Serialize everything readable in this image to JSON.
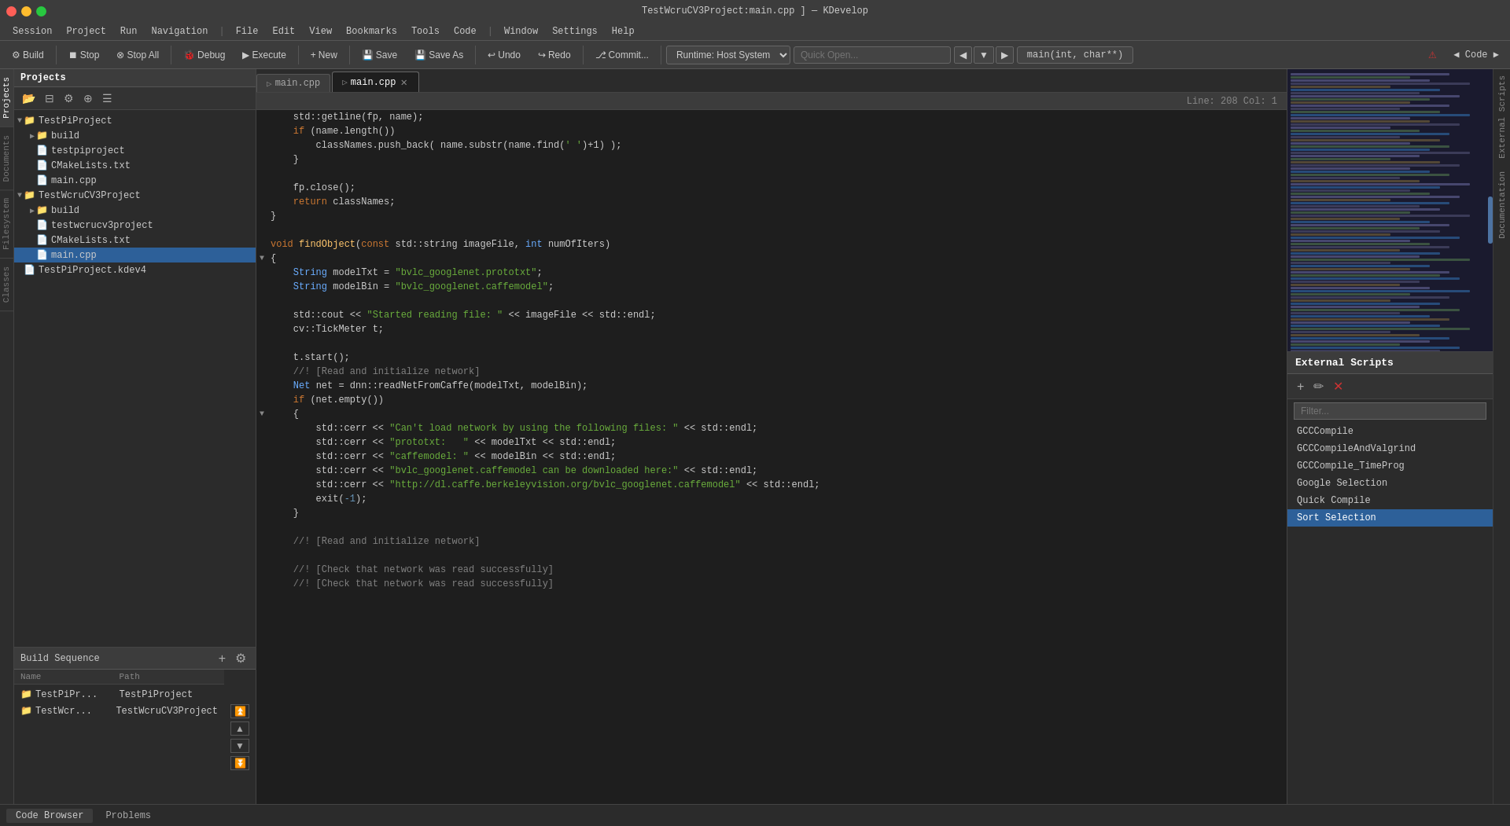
{
  "window": {
    "title": "TestWcruCV3Project:main.cpp ] — KDevelop"
  },
  "window_buttons": {
    "close": "●",
    "minimize": "●",
    "maximize": "●"
  },
  "menubar": {
    "items": [
      "Session",
      "Project",
      "Run",
      "Navigation",
      "|",
      "File",
      "Edit",
      "View",
      "Bookmarks",
      "Tools",
      "Code",
      "|",
      "Window",
      "Settings",
      "Help"
    ]
  },
  "toolbar": {
    "build": "Build",
    "stop": "Stop",
    "stop_all": "Stop All",
    "debug": "Debug",
    "execute": "Execute",
    "new": "New",
    "save": "Save",
    "save_as": "Save As",
    "undo": "Undo",
    "redo": "Redo",
    "commit": "Commit...",
    "runtime": "Runtime: Host System",
    "quick_open": "Quick Open...",
    "function_display": "main(int, char**)",
    "code_label": "◀ Code ▶"
  },
  "tabs": {
    "items": [
      {
        "label": "main.cpp",
        "icon": "▷",
        "active": false,
        "closable": false
      },
      {
        "label": "main.cpp",
        "icon": "▷",
        "active": true,
        "closable": true
      }
    ]
  },
  "status_line": {
    "text": "Line: 208 Col: 1"
  },
  "code": {
    "lines": [
      {
        "num": "",
        "content": "    std::getline(fp, name);",
        "tokens": [
          {
            "t": "ns",
            "v": "    std::getline"
          },
          {
            "t": "plain",
            "v": "(fp, name);"
          }
        ]
      },
      {
        "num": "",
        "content": "    if (name.length())",
        "tokens": [
          {
            "t": "plain",
            "v": "    "
          },
          {
            "t": "kw",
            "v": "if"
          },
          {
            "t": "plain",
            "v": " (name.length())"
          }
        ]
      },
      {
        "num": "",
        "content": "        classNames.push_back( name.substr(name.find(' ')+1) );",
        "tokens": [
          {
            "t": "plain",
            "v": "        classNames.push_back( name.substr(name.find("
          },
          {
            "t": "str",
            "v": "' '"
          },
          {
            "t": "plain",
            "v": ")+1) );"
          }
        ]
      },
      {
        "num": "",
        "content": "    }",
        "tokens": [
          {
            "t": "plain",
            "v": "    }"
          }
        ]
      },
      {
        "num": "",
        "content": "",
        "tokens": []
      },
      {
        "num": "",
        "content": "    fp.close();",
        "tokens": [
          {
            "t": "plain",
            "v": "    fp.close();"
          }
        ]
      },
      {
        "num": "",
        "content": "    return classNames;",
        "tokens": [
          {
            "t": "plain",
            "v": "    "
          },
          {
            "t": "kw",
            "v": "return"
          },
          {
            "t": "plain",
            "v": " classNames;"
          }
        ]
      },
      {
        "num": "",
        "content": "}",
        "tokens": [
          {
            "t": "plain",
            "v": "}"
          }
        ]
      },
      {
        "num": "",
        "content": "",
        "tokens": []
      },
      {
        "num": "",
        "content": "void findObject(const std::string imageFile, int numOfIters)",
        "tokens": [
          {
            "t": "kw",
            "v": "void"
          },
          {
            "t": "plain",
            "v": " "
          },
          {
            "t": "func",
            "v": "findObject"
          },
          {
            "t": "plain",
            "v": "("
          },
          {
            "t": "kw",
            "v": "const"
          },
          {
            "t": "plain",
            "v": " std::string imageFile, "
          },
          {
            "t": "type",
            "v": "int"
          },
          {
            "t": "plain",
            "v": " numOfIters)"
          }
        ]
      },
      {
        "num": "",
        "content": "{",
        "tokens": [
          {
            "t": "plain",
            "v": "{"
          }
        ]
      },
      {
        "num": "",
        "content": "    String modelTxt = \"bvlc_googlenet.prototxt\";",
        "tokens": [
          {
            "t": "plain",
            "v": "    "
          },
          {
            "t": "type",
            "v": "String"
          },
          {
            "t": "plain",
            "v": " modelTxt = "
          },
          {
            "t": "str",
            "v": "\"bvlc_googlenet.prototxt\""
          },
          {
            "t": "plain",
            "v": ";"
          }
        ]
      },
      {
        "num": "",
        "content": "    String modelBin = \"bvlc_googlenet.caffemodel\";",
        "tokens": [
          {
            "t": "plain",
            "v": "    "
          },
          {
            "t": "type",
            "v": "String"
          },
          {
            "t": "plain",
            "v": " modelBin = "
          },
          {
            "t": "str",
            "v": "\"bvlc_googlenet.caffemodel\""
          },
          {
            "t": "plain",
            "v": ";"
          }
        ]
      },
      {
        "num": "",
        "content": "",
        "tokens": []
      },
      {
        "num": "",
        "content": "    std::cout << \"Started reading file: \" << imageFile << std::endl;",
        "tokens": [
          {
            "t": "plain",
            "v": "    std::cout << "
          },
          {
            "t": "str",
            "v": "\"Started reading file: \""
          },
          {
            "t": "plain",
            "v": " << imageFile << std::endl;"
          }
        ]
      },
      {
        "num": "",
        "content": "    cv::TickMeter t;",
        "tokens": [
          {
            "t": "plain",
            "v": "    cv::TickMeter t;"
          }
        ]
      },
      {
        "num": "",
        "content": "",
        "tokens": []
      },
      {
        "num": "",
        "content": "    t.start();",
        "tokens": [
          {
            "t": "plain",
            "v": "    t.start();"
          }
        ]
      },
      {
        "num": "",
        "content": "    //! [Read and initialize network]",
        "tokens": [
          {
            "t": "comment",
            "v": "    //! [Read and initialize network]"
          }
        ]
      },
      {
        "num": "",
        "content": "    Net net = dnn::readNetFromCaffe(modelTxt, modelBin);",
        "tokens": [
          {
            "t": "plain",
            "v": "    "
          },
          {
            "t": "type",
            "v": "Net"
          },
          {
            "t": "plain",
            "v": " net = dnn::readNetFromCaffe(modelTxt, modelBin);"
          }
        ]
      },
      {
        "num": "",
        "content": "    if (net.empty())",
        "tokens": [
          {
            "t": "plain",
            "v": "    "
          },
          {
            "t": "kw",
            "v": "if"
          },
          {
            "t": "plain",
            "v": " (net.empty())"
          }
        ]
      },
      {
        "num": "",
        "content": "    {",
        "tokens": [
          {
            "t": "plain",
            "v": "    {"
          }
        ]
      },
      {
        "num": "",
        "content": "        std::cerr << \"Can't load network by using the following files: \" << std::endl;",
        "tokens": [
          {
            "t": "plain",
            "v": "        std::cerr << "
          },
          {
            "t": "str",
            "v": "\"Can't load network by using the following files: \""
          },
          {
            "t": "plain",
            "v": " << std::endl;"
          }
        ]
      },
      {
        "num": "",
        "content": "        std::cerr << \"prototxt:   \" << modelTxt << std::endl;",
        "tokens": [
          {
            "t": "plain",
            "v": "        std::cerr << "
          },
          {
            "t": "str",
            "v": "\"prototxt:   \""
          },
          {
            "t": "plain",
            "v": " << modelTxt << std::endl;"
          }
        ]
      },
      {
        "num": "",
        "content": "        std::cerr << \"caffemodel: \" << modelBin << std::endl;",
        "tokens": [
          {
            "t": "plain",
            "v": "        std::cerr << "
          },
          {
            "t": "str",
            "v": "\"caffemodel: \""
          },
          {
            "t": "plain",
            "v": " << modelBin << std::endl;"
          }
        ]
      },
      {
        "num": "",
        "content": "        std::cerr << \"bvlc_googlenet.caffemodel can be downloaded here:\" << std::endl;",
        "tokens": [
          {
            "t": "plain",
            "v": "        std::cerr << "
          },
          {
            "t": "str",
            "v": "\"bvlc_googlenet.caffemodel can be downloaded here:\""
          },
          {
            "t": "plain",
            "v": " << std::endl;"
          }
        ]
      },
      {
        "num": "",
        "content": "        std::cerr << \"http://dl.caffe.berkeleyvision.org/bvlc_googlenet.caffemodel\" << std::endl;",
        "tokens": [
          {
            "t": "plain",
            "v": "        std::cerr << "
          },
          {
            "t": "str",
            "v": "\"http://dl.caffe.berkeleyvision.org/bvlc_googlenet.caffemodel\""
          },
          {
            "t": "plain",
            "v": " << std::endl;"
          }
        ]
      },
      {
        "num": "",
        "content": "        exit(-1);",
        "tokens": [
          {
            "t": "plain",
            "v": "        exit("
          },
          {
            "t": "num",
            "v": "-1"
          },
          {
            "t": "plain",
            "v": ");"
          }
        ]
      },
      {
        "num": "",
        "content": "    }",
        "tokens": [
          {
            "t": "plain",
            "v": "    }"
          }
        ]
      },
      {
        "num": "",
        "content": "",
        "tokens": []
      },
      {
        "num": "",
        "content": "    //! [Read and initialize network]",
        "tokens": [
          {
            "t": "comment",
            "v": "    //! [Read and initialize network]"
          }
        ]
      },
      {
        "num": "",
        "content": "",
        "tokens": []
      },
      {
        "num": "",
        "content": "    //! [Check that network was read successfully]",
        "tokens": [
          {
            "t": "comment",
            "v": "    //! [Check that network was read successfully]"
          }
        ]
      },
      {
        "num": "",
        "content": "    //! [Check that network was read successfully]",
        "tokens": [
          {
            "t": "comment",
            "v": "    //! [Check that network was read successfully]"
          }
        ]
      }
    ]
  },
  "projects": {
    "header": "Projects",
    "tree": [
      {
        "level": 0,
        "type": "folder",
        "label": "TestPiProject",
        "expanded": true
      },
      {
        "level": 1,
        "type": "folder",
        "label": "build",
        "expanded": false
      },
      {
        "level": 1,
        "type": "file",
        "label": "testpiproject",
        "ext": ""
      },
      {
        "level": 1,
        "type": "file",
        "label": "CMakeLists.txt",
        "ext": "txt"
      },
      {
        "level": 1,
        "type": "file",
        "label": "main.cpp",
        "ext": "cpp"
      },
      {
        "level": 0,
        "type": "folder",
        "label": "TestWcruCV3Project",
        "expanded": true
      },
      {
        "level": 1,
        "type": "folder",
        "label": "build",
        "expanded": false
      },
      {
        "level": 1,
        "type": "file",
        "label": "testwcrucv3project",
        "ext": ""
      },
      {
        "level": 1,
        "type": "file",
        "label": "CMakeLists.txt",
        "ext": "txt"
      },
      {
        "level": 1,
        "type": "file",
        "label": "main.cpp",
        "ext": "cpp",
        "selected": true
      },
      {
        "level": 0,
        "type": "file",
        "label": "TestPiProject.kdev4",
        "ext": "kdev4"
      }
    ]
  },
  "build_sequence": {
    "header": "Build Sequence",
    "columns": [
      "Name",
      "Path"
    ],
    "rows": [
      {
        "name": "TestPiPr...",
        "path": "TestPiProject"
      },
      {
        "name": "TestWcr...",
        "path": "TestWcruCV3Project"
      }
    ]
  },
  "external_scripts": {
    "header": "External Scripts",
    "filter_placeholder": "Filter...",
    "items": [
      {
        "label": "GCCCompile",
        "selected": false
      },
      {
        "label": "GCCCompileAndValgrind",
        "selected": false
      },
      {
        "label": "GCCCompile_TimeProg",
        "selected": false
      },
      {
        "label": "Google Selection",
        "selected": false
      },
      {
        "label": "Quick Compile",
        "selected": false
      },
      {
        "label": "Sort Selection",
        "selected": true
      }
    ]
  },
  "right_tabs": [
    {
      "label": "External Scripts"
    },
    {
      "label": "Documentation"
    }
  ],
  "left_side_labels": [
    {
      "label": "Projects"
    },
    {
      "label": "Documents"
    },
    {
      "label": "Filesystem"
    },
    {
      "label": "Classes"
    }
  ],
  "statusbar": {
    "code_browser": "Code Browser",
    "problems": "Problems"
  },
  "colors": {
    "selected_blue": "#2d6099",
    "sort_selection_bg": "#2d6099",
    "keyword": "#cc7832",
    "string": "#6aad3d",
    "comment": "#808080",
    "type_blue": "#6aadff",
    "func_yellow": "#ffc66d"
  }
}
